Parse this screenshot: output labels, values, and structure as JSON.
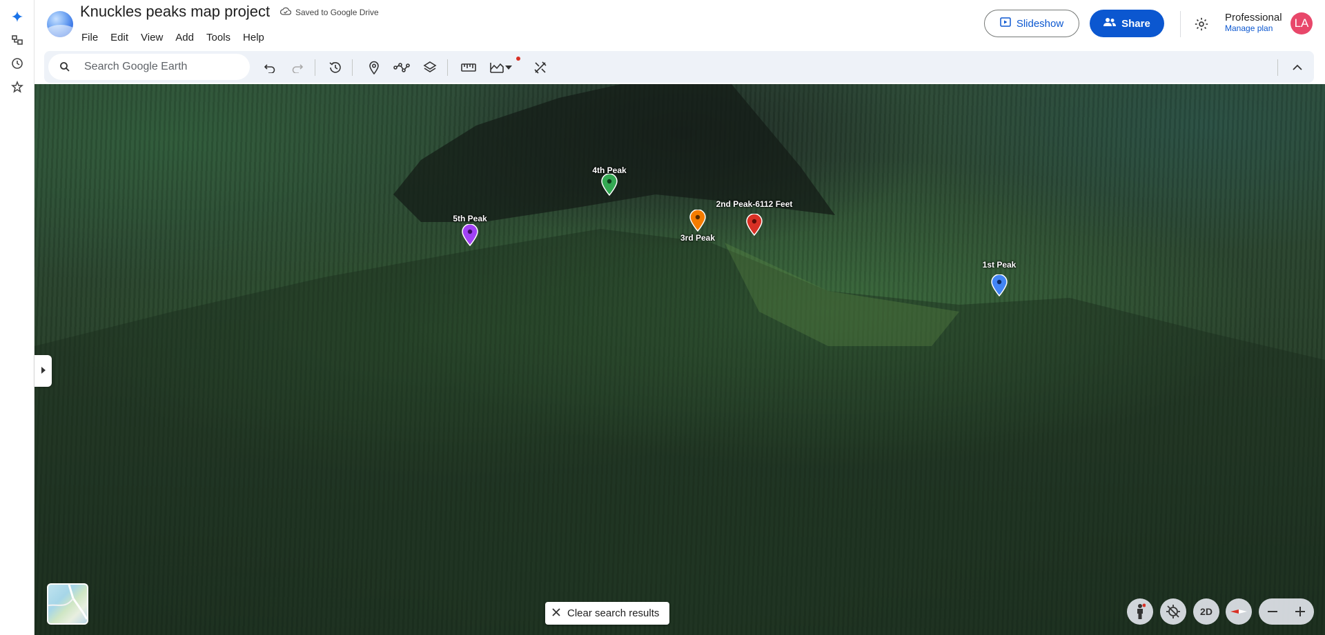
{
  "app": {
    "title": "Knuckles peaks map project",
    "save_status": "Saved to Google Drive"
  },
  "menu": [
    "File",
    "Edit",
    "View",
    "Add",
    "Tools",
    "Help"
  ],
  "header": {
    "slideshow_label": "Slideshow",
    "share_label": "Share",
    "plan_name": "Professional",
    "plan_link": "Manage plan",
    "avatar_initials": "LA"
  },
  "search": {
    "placeholder": "Search Google Earth",
    "value": ""
  },
  "toolbar_icons": [
    "undo-icon",
    "redo-icon",
    "historical-imagery-icon",
    "add-placemark-icon",
    "draw-path-icon",
    "layers-icon",
    "measure-icon",
    "data-layer-icon",
    "dropdown-icon",
    "tools-icon",
    "collapse-icon"
  ],
  "placemarks": [
    {
      "label": "4th Peak",
      "color": "#34a853"
    },
    {
      "label": "5th Peak",
      "color": "#a142f4"
    },
    {
      "label": "3rd Peak",
      "color": "#f57c00"
    },
    {
      "label": "2nd Peak-6112 Feet",
      "color": "#d93025"
    },
    {
      "label": "1st Peak",
      "color": "#4285f4"
    }
  ],
  "map_controls": {
    "clear_search_label": "Clear search results",
    "view_mode_label": "2D"
  },
  "colors": {
    "primary": "#0b57d0",
    "avatar": "#e8476a",
    "toolbar_bg": "#eef2f8"
  }
}
